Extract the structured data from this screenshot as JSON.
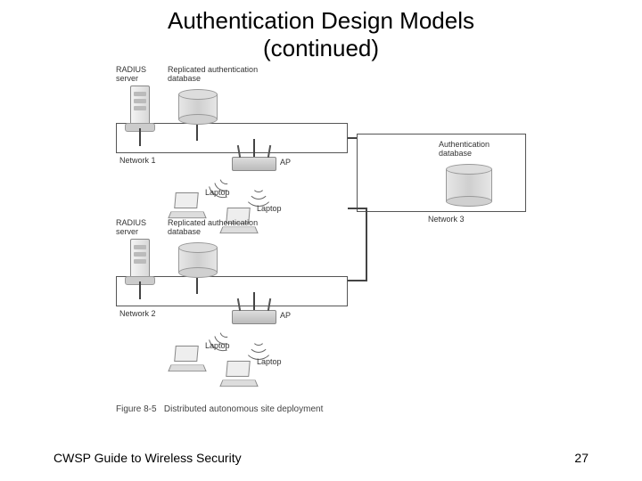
{
  "title_line1": "Authentication Design Models",
  "title_line2": "(continued)",
  "footer_left": "CWSP Guide to Wireless Security",
  "footer_right": "27",
  "diagram": {
    "labels": {
      "radius_server_1": "RADIUS\nserver",
      "replicated_db_1": "Replicated authentication\ndatabase",
      "network_1": "Network 1",
      "ap_1": "AP",
      "laptop_1a": "Laptop",
      "laptop_1b": "Laptop",
      "auth_db": "Authentication\ndatabase",
      "network_3": "Network 3",
      "radius_server_2": "RADIUS\nserver",
      "replicated_db_2": "Replicated authentication\ndatabase",
      "network_2": "Network 2",
      "ap_2": "AP",
      "laptop_2a": "Laptop",
      "laptop_2b": "Laptop"
    },
    "caption_prefix": "Figure 8-5",
    "caption_text": "Distributed autonomous site deployment"
  }
}
